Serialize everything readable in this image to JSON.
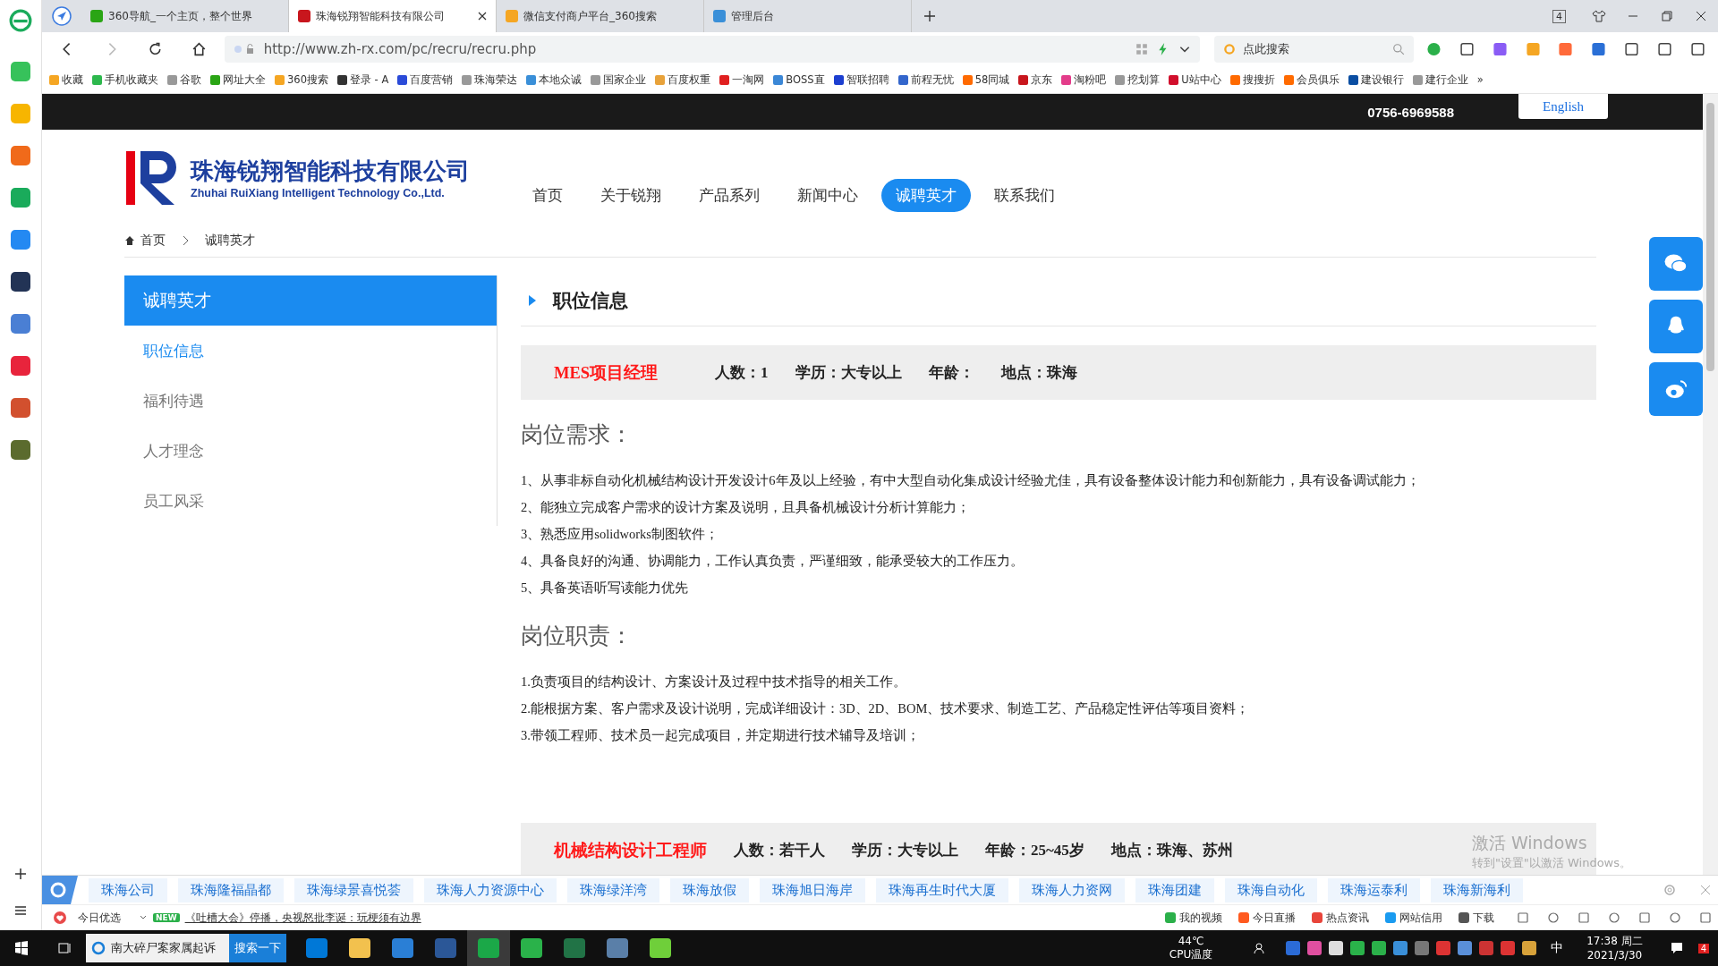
{
  "tabs": [
    {
      "title": "360导航_一个主页，整个世界",
      "selected": false
    },
    {
      "title": "珠海锐翔智能科技有限公司",
      "selected": true
    },
    {
      "title": "微信支付商户平台_360搜索",
      "selected": false
    },
    {
      "title": "管理后台",
      "selected": false
    }
  ],
  "window_controls": {
    "tab_count": "4"
  },
  "address_bar": {
    "url": "http://www.zh-rx.com/pc/recru/recru.php"
  },
  "search_box": {
    "placeholder": "点此搜索"
  },
  "bookmarks": [
    "收藏",
    "手机收藏夹",
    "谷歌",
    "网址大全",
    "360搜索",
    "登录 - A",
    "百度营销",
    "珠海荣达",
    "本地众诚",
    "国家企业",
    "百度权重",
    "一淘网",
    "BOSS直",
    "智联招聘",
    "前程无忧",
    "58同城",
    "京东",
    "淘粉吧",
    "挖划算",
    "U站中心",
    "搜搜折",
    "会员俱乐",
    "建设银行",
    "建行企业",
    "»"
  ],
  "page": {
    "top_bar": {
      "phone": "0756-6969588",
      "language_button": "English"
    },
    "logo": {
      "name": "珠海锐翔智能科技有限公司",
      "english": "Zhuhai RuiXiang Intelligent Technology Co.,Ltd."
    },
    "nav": [
      {
        "label": "首页",
        "selected": false
      },
      {
        "label": "关于锐翔",
        "selected": false
      },
      {
        "label": "产品系列",
        "selected": false
      },
      {
        "label": "新闻中心",
        "selected": false
      },
      {
        "label": "诚聘英才",
        "selected": true
      },
      {
        "label": "联系我们",
        "selected": false
      }
    ],
    "breadcrumb": [
      "首页",
      "诚聘英才"
    ],
    "side_menu": {
      "title": "诚聘英才",
      "items": [
        {
          "label": "职位信息",
          "selected": true
        },
        {
          "label": "福利待遇",
          "selected": false
        },
        {
          "label": "人才理念",
          "selected": false
        },
        {
          "label": "员工风采",
          "selected": false
        }
      ]
    },
    "section_title": "职位信息",
    "jobs": [
      {
        "title": "MES项目经理",
        "meta": [
          "人数：1",
          "学历：大专以上",
          "年龄：",
          "地点：珠海"
        ],
        "sections": [
          {
            "heading": "岗位需求：",
            "lines": [
              "1、从事非标自动化机械结构设计开发设计6年及以上经验，有中大型自动化集成设计经验尤佳，具有设备整体设计能力和创新能力，具有设备调试能力；",
              "2、能独立完成客户需求的设计方案及说明，且具备机械设计分析计算能力；",
              "3、熟悉应用solidworks制图软件；",
              "4、具备良好的沟通、协调能力，工作认真负责，严谨细致，能承受较大的工作压力。",
              "5、具备英语听写读能力优先"
            ]
          },
          {
            "heading": "岗位职责：",
            "lines": [
              "1.负责项目的结构设计、方案设计及过程中技术指导的相关工作。",
              "2.能根据方案、客户需求及设计说明，完成详细设计：3D、2D、BOM、技术要求、制造工艺、产品稳定性评估等项目资料；",
              "3.带领工程师、技术员一起完成项目，并定期进行技术辅导及培训；"
            ]
          }
        ]
      },
      {
        "title": "机械结构设计工程师",
        "meta": [
          "人数：若干人",
          "学历：大专以上",
          "年龄：25~45岁",
          "地点：珠海、苏州"
        ]
      }
    ]
  },
  "activation_notice": [
    "激活 Windows",
    "转到\"设置\"以激活 Windows。"
  ],
  "hot_searches": [
    "珠海公司",
    "珠海隆福晶都",
    "珠海绿景喜悦荟",
    "珠海人力资源中心",
    "珠海绿洋湾",
    "珠海放假",
    "珠海旭日海岸",
    "珠海再生时代大厦",
    "珠海人力资网",
    "珠海团建",
    "珠海自动化",
    "珠海运泰利",
    "珠海新海利"
  ],
  "news_bar": {
    "label": "今日优选",
    "badge": "NEW",
    "headline": "《吐槽大会》停播，央视怒批李诞：玩梗须有边界",
    "links": [
      "我的视频",
      "今日直播",
      "热点资讯",
      "网站信用",
      "下载"
    ]
  },
  "taskbar": {
    "search_text": "南大碎尸案家属起诉",
    "search_button": "搜索一下",
    "temperature": "44℃",
    "temperature_label": "CPU温度",
    "ime": "中",
    "time": "17:38 周二",
    "date": "2021/3/30",
    "notification_count": "4"
  }
}
